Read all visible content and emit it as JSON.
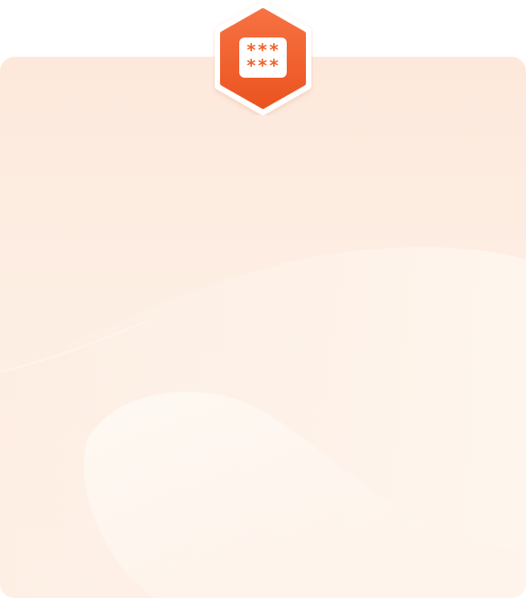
{
  "badge": {
    "icon": "password-mask-icon",
    "line1": "***",
    "line2": "***"
  },
  "colors": {
    "accent": "#f2622b",
    "accent_dark": "#e9511f",
    "card_background": "#fdeadd",
    "wave_light": "#fef4eb"
  }
}
